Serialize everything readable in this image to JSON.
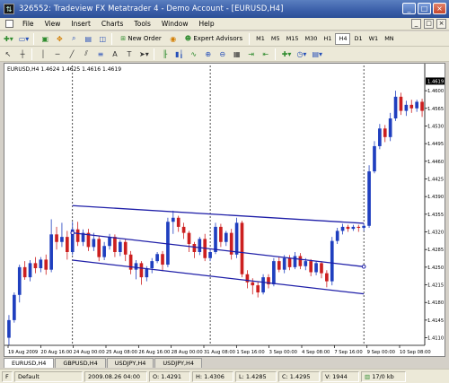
{
  "window": {
    "title": "326552: Tradeview FX Metatrader 4 - Demo Account - [EURUSD,H4]",
    "controls": [
      "_",
      "□",
      "×"
    ]
  },
  "menu": {
    "items": [
      "File",
      "View",
      "Insert",
      "Charts",
      "Tools",
      "Window",
      "Help"
    ],
    "mdi_controls": [
      "_",
      "□",
      "×"
    ]
  },
  "toolbar": {
    "new_order_label": "New Order",
    "expert_advisors_label": "Expert Advisors",
    "timeframes": [
      "M1",
      "M5",
      "M15",
      "M30",
      "H1",
      "H4",
      "D1",
      "W1",
      "MN"
    ],
    "active_timeframe": "H4"
  },
  "chart_header": "EURUSD,H4  1.4624 1.4625 1.4616 1.4619",
  "chart_data": {
    "type": "candlestick",
    "symbol": "EURUSD",
    "timeframe": "H4",
    "ylim": [
      1.4095,
      1.465
    ],
    "y_ticks": [
      "1.4619",
      "1.4600",
      "1.4565",
      "1.4530",
      "1.4495",
      "1.4460",
      "1.4425",
      "1.4390",
      "1.4355",
      "1.4320",
      "1.4285",
      "1.4250",
      "1.4215",
      "1.4180",
      "1.4145",
      "1.4110"
    ],
    "current_price": "1.4619",
    "x_labels": [
      "19 Aug 2009",
      "20 Aug 16:00",
      "24 Aug 00:00",
      "25 Aug 08:00",
      "26 Aug 16:00",
      "28 Aug 00:00",
      "31 Aug 08:00",
      "1 Sep 16:00",
      "3 Sep 00:00",
      "4 Sep 08:00",
      "7 Sep 16:00",
      "9 Sep 00:00",
      "10 Sep 08:00"
    ],
    "up_color": "#1f3fbf",
    "down_color": "#cc1f1f",
    "channel": {
      "upper": [
        [
          12,
          1.4372
        ],
        [
          67,
          1.4337
        ]
      ],
      "middle": [
        [
          12,
          1.4318
        ],
        [
          67,
          1.4251
        ]
      ],
      "lower": [
        [
          12,
          1.4264
        ],
        [
          67,
          1.4197
        ]
      ],
      "line_color": "#1f1fa8"
    },
    "vertical_markers": [
      12,
      38,
      67
    ],
    "candles": [
      [
        1.411,
        1.4145,
        1.4095,
        1.4155
      ],
      [
        1.4145,
        1.4195,
        1.414,
        1.42
      ],
      [
        1.4195,
        1.425,
        1.418,
        1.4255
      ],
      [
        1.425,
        1.423,
        1.4225,
        1.4262
      ],
      [
        1.423,
        1.4258,
        1.4222,
        1.4264
      ],
      [
        1.4258,
        1.4248,
        1.4238,
        1.427
      ],
      [
        1.4248,
        1.4265,
        1.424,
        1.427
      ],
      [
        1.4265,
        1.4245,
        1.4235,
        1.4275
      ],
      [
        1.4245,
        1.4315,
        1.424,
        1.4345
      ],
      [
        1.4315,
        1.43,
        1.4285,
        1.433
      ],
      [
        1.43,
        1.431,
        1.429,
        1.4338
      ],
      [
        1.431,
        1.428,
        1.4265,
        1.4322
      ],
      [
        1.428,
        1.4325,
        1.4274,
        1.434
      ],
      [
        1.4325,
        1.43,
        1.4292,
        1.434
      ],
      [
        1.43,
        1.4318,
        1.4292,
        1.4325
      ],
      [
        1.4318,
        1.429,
        1.4282,
        1.4326
      ],
      [
        1.429,
        1.4306,
        1.4282,
        1.4318
      ],
      [
        1.4306,
        1.427,
        1.4262,
        1.4312
      ],
      [
        1.427,
        1.4292,
        1.4264,
        1.43
      ],
      [
        1.4292,
        1.431,
        1.4285,
        1.4316
      ],
      [
        1.431,
        1.428,
        1.427,
        1.4315
      ],
      [
        1.428,
        1.43,
        1.4272,
        1.4304
      ],
      [
        1.43,
        1.4275,
        1.4262,
        1.4306
      ],
      [
        1.4275,
        1.4245,
        1.4236,
        1.4282
      ],
      [
        1.4245,
        1.4258,
        1.4226,
        1.4264
      ],
      [
        1.4258,
        1.423,
        1.4215,
        1.4262
      ],
      [
        1.423,
        1.4248,
        1.4222,
        1.4252
      ],
      [
        1.4248,
        1.4262,
        1.4238,
        1.4268
      ],
      [
        1.4262,
        1.4276,
        1.4258,
        1.428
      ],
      [
        1.4276,
        1.4255,
        1.4242,
        1.4282
      ],
      [
        1.4255,
        1.434,
        1.425,
        1.4348
      ],
      [
        1.434,
        1.4348,
        1.4316,
        1.4362
      ],
      [
        1.4348,
        1.433,
        1.432,
        1.4352
      ],
      [
        1.433,
        1.4318,
        1.4306,
        1.4338
      ],
      [
        1.4318,
        1.4296,
        1.428,
        1.4322
      ],
      [
        1.4296,
        1.428,
        1.4268,
        1.43
      ],
      [
        1.428,
        1.4306,
        1.4274,
        1.431
      ],
      [
        1.4306,
        1.4268,
        1.4262,
        1.4316
      ],
      [
        1.4268,
        1.428,
        1.4262,
        1.4286
      ],
      [
        1.428,
        1.433,
        1.4276,
        1.4338
      ],
      [
        1.433,
        1.43,
        1.429,
        1.4336
      ],
      [
        1.43,
        1.4318,
        1.4292,
        1.4322
      ],
      [
        1.4318,
        1.4275,
        1.4265,
        1.4326
      ],
      [
        1.4275,
        1.4338,
        1.4268,
        1.4348
      ],
      [
        1.4338,
        1.4236,
        1.423,
        1.4342
      ],
      [
        1.4236,
        1.422,
        1.4208,
        1.4244
      ],
      [
        1.422,
        1.4214,
        1.4196,
        1.4228
      ],
      [
        1.4214,
        1.42,
        1.419,
        1.4222
      ],
      [
        1.42,
        1.423,
        1.4196,
        1.4236
      ],
      [
        1.423,
        1.4216,
        1.4208,
        1.4236
      ],
      [
        1.4216,
        1.4262,
        1.4212,
        1.4268
      ],
      [
        1.4262,
        1.4245,
        1.424,
        1.427
      ],
      [
        1.4245,
        1.4268,
        1.4238,
        1.4274
      ],
      [
        1.4268,
        1.425,
        1.4244,
        1.4274
      ],
      [
        1.425,
        1.4272,
        1.4246,
        1.428
      ],
      [
        1.4272,
        1.4252,
        1.4246,
        1.4278
      ],
      [
        1.4252,
        1.4262,
        1.4244,
        1.4268
      ],
      [
        1.4262,
        1.424,
        1.4232,
        1.4266
      ],
      [
        1.424,
        1.4258,
        1.4234,
        1.4262
      ],
      [
        1.4258,
        1.4238,
        1.4228,
        1.4262
      ],
      [
        1.4238,
        1.4222,
        1.421,
        1.4244
      ],
      [
        1.4222,
        1.4302,
        1.4214,
        1.431
      ],
      [
        1.4302,
        1.4322,
        1.4296,
        1.4328
      ],
      [
        1.4322,
        1.433,
        1.4315,
        1.4336
      ],
      [
        1.433,
        1.4326,
        1.432,
        1.4334
      ],
      [
        1.4326,
        1.433,
        1.4322,
        1.4334
      ],
      [
        1.433,
        1.4328,
        1.432,
        1.4334
      ],
      [
        1.4328,
        1.4332,
        1.4322,
        1.4336
      ],
      [
        1.4332,
        1.444,
        1.4328,
        1.4452
      ],
      [
        1.444,
        1.449,
        1.4436,
        1.45
      ],
      [
        1.449,
        1.4525,
        1.4484,
        1.4534
      ],
      [
        1.4525,
        1.4508,
        1.4498,
        1.4532
      ],
      [
        1.4508,
        1.4545,
        1.45,
        1.4556
      ],
      [
        1.4545,
        1.4588,
        1.454,
        1.46
      ],
      [
        1.4588,
        1.456,
        1.4552,
        1.4596
      ],
      [
        1.456,
        1.4572,
        1.455,
        1.458
      ],
      [
        1.4572,
        1.4565,
        1.4556,
        1.4582
      ],
      [
        1.4565,
        1.4578,
        1.4558,
        1.4582
      ],
      [
        1.4578,
        1.456,
        1.4548,
        1.4584
      ]
    ]
  },
  "tabs": [
    "EURUSD,H4",
    "GBPUSD,H4",
    "USDJPY,H4",
    "USDJPY,H4"
  ],
  "active_tab": "EURUSD,H4",
  "status": {
    "help": "F",
    "profile": "Default",
    "datetime": "2009.08.26 04:00",
    "open": "O: 1.4291",
    "high": "H: 1.4306",
    "low": "L: 1.4285",
    "close": "C: 1.4295",
    "volume": "V: 1944",
    "traffic": "17/0 kb"
  }
}
